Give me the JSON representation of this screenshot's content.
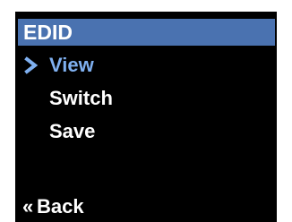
{
  "title": "EDID",
  "menu": {
    "items": [
      {
        "label": "View",
        "selected": true
      },
      {
        "label": "Switch",
        "selected": false
      },
      {
        "label": "Save",
        "selected": false
      }
    ],
    "cursor_icon": "chevron-right-icon"
  },
  "back": {
    "glyph": "«",
    "label": "Back"
  },
  "colors": {
    "title_bar": "#4a72b0",
    "selected_text": "#7fb0f0",
    "text": "#ffffff",
    "background": "#000000"
  }
}
